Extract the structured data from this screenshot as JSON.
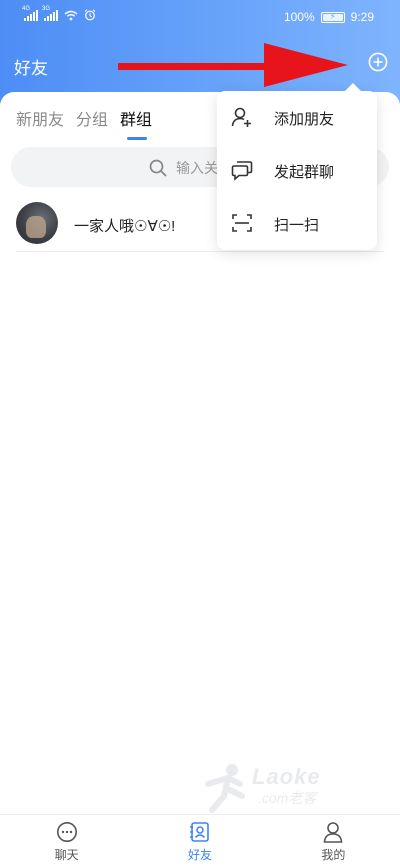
{
  "status_bar": {
    "signal1_tag": "4G",
    "signal2_tag": "3G",
    "battery_pct": "100%",
    "time": "9:29"
  },
  "header": {
    "title": "好友"
  },
  "tabs": [
    {
      "label": "新朋友",
      "active": false
    },
    {
      "label": "分组",
      "active": false
    },
    {
      "label": "群组",
      "active": true
    }
  ],
  "search": {
    "placeholder": "输入关"
  },
  "groups": [
    {
      "name": "一家人哦☉∀☉!"
    }
  ],
  "menu": {
    "items": [
      {
        "label": "添加朋友",
        "icon": "add-friend-icon"
      },
      {
        "label": "发起群聊",
        "icon": "group-chat-icon"
      },
      {
        "label": "扫一扫",
        "icon": "scan-icon"
      }
    ]
  },
  "watermark": {
    "brand": "Laoke",
    "sub": ".com老客"
  },
  "bottom_nav": [
    {
      "label": "聊天",
      "icon": "chat-icon",
      "active": false
    },
    {
      "label": "好友",
      "icon": "contacts-icon",
      "active": true
    },
    {
      "label": "我的",
      "icon": "profile-icon",
      "active": false
    }
  ],
  "colors": {
    "accent": "#3d83f3",
    "header_start": "#4d8df5",
    "header_end": "#7fb4fd",
    "annotation_arrow": "#e8141b"
  }
}
